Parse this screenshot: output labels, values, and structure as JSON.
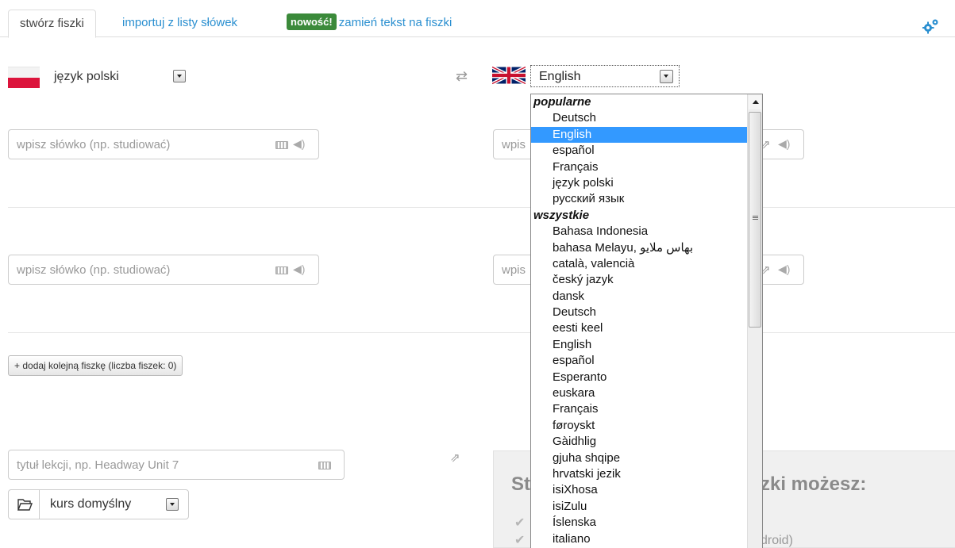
{
  "tabs": {
    "create": "stwórz fiszki",
    "import": "importuj z listy słówek",
    "new_badge": "nowość!",
    "convert": "zamień tekst na fiszki"
  },
  "source_lang": {
    "label": "język polski"
  },
  "target_lang": {
    "selected": "English"
  },
  "word_input": {
    "placeholder": "wpisz słówko (np. studiować)",
    "target_placeholder": "wpis"
  },
  "add_button": "+ dodaj kolejną fiszkę (liczba fiszek: 0)",
  "lesson": {
    "placeholder": "tytuł lekcji, np. Headway Unit 7"
  },
  "course": {
    "label": "kurs domyślny"
  },
  "promo": {
    "title_start": "St",
    "title_end": "zki możesz:",
    "line_end": "droid)"
  },
  "dropdown": {
    "popular_label": "popularne",
    "popular": [
      "Deutsch",
      "English",
      "español",
      "Français",
      "język polski",
      "русский язык"
    ],
    "all_label": "wszystkie",
    "all": [
      "Bahasa Indonesia",
      "bahasa Melayu, بهاس ملايو",
      "català, valencià",
      "český jazyk",
      "dansk",
      "Deutsch",
      "eesti keel",
      "English",
      "español",
      "Esperanto",
      "euskara",
      "Français",
      "føroyskt",
      "Gàidhlig",
      "gjuha shqipe",
      "hrvatski jezik",
      "isiXhosa",
      "isiZulu",
      "Íslenska",
      "italiano"
    ]
  },
  "colors": {
    "link": "#2a8fd0",
    "badge": "#3b8a3a",
    "selected": "#3399ff"
  }
}
